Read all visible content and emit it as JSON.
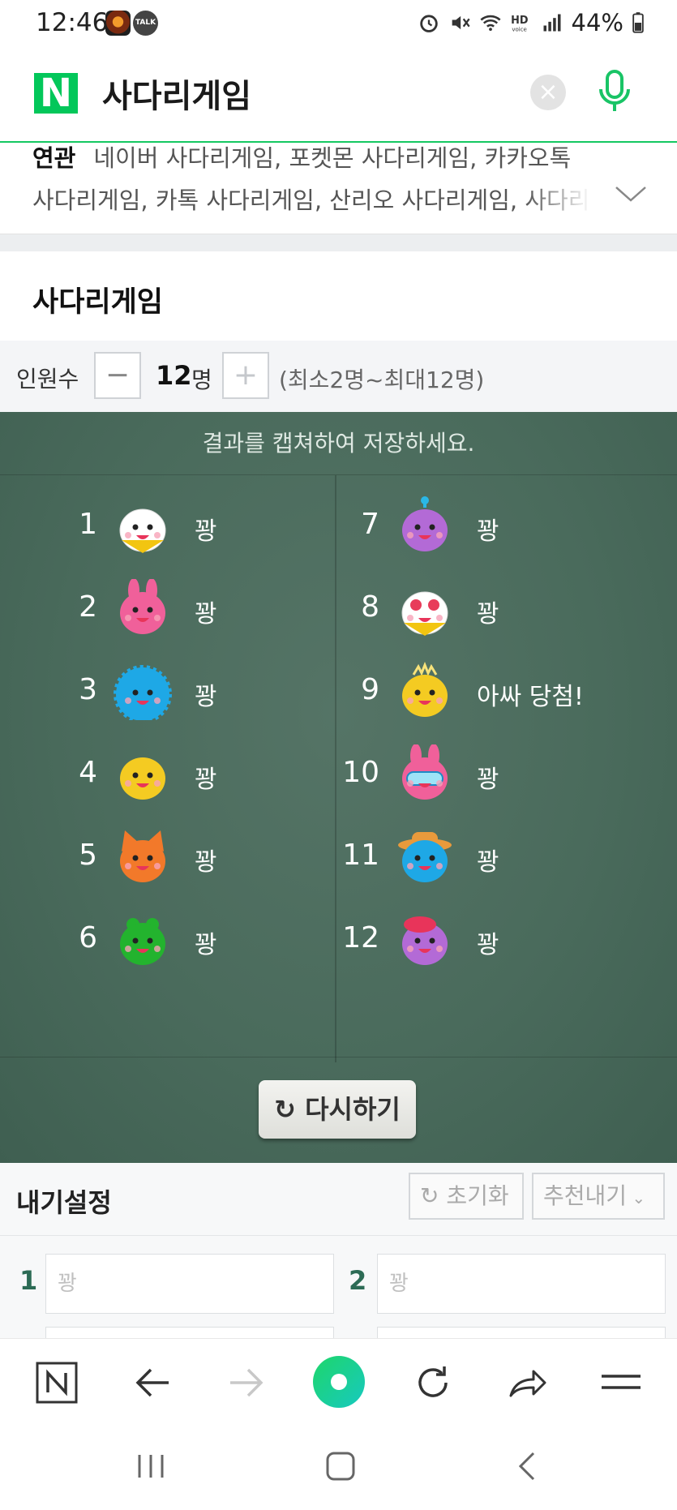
{
  "status_bar": {
    "time": "12:46",
    "battery": "44%"
  },
  "search": {
    "query": "사다리게임",
    "logo": "N",
    "clear_label": "×"
  },
  "related": {
    "label": "연관",
    "line1": "네이버 사다리게임, 포켓몬 사다리게임, 카카오톡",
    "line2": "사다리게임, 카톡 사다리게임, 산리오 사다리게임, 사다리"
  },
  "section_title": "사다리게임",
  "count": {
    "label": "인원수",
    "minus": "−",
    "value": "12",
    "unit": "명",
    "plus": "+",
    "range": "(최소2명~최대12명)"
  },
  "board": {
    "message": "결과를 캡쳐하여 저장하세요.",
    "retry_label": "다시하기",
    "players": [
      {
        "num": "1",
        "result": "꽝",
        "avatar": "white-bear"
      },
      {
        "num": "2",
        "result": "꽝",
        "avatar": "pink-rabbit"
      },
      {
        "num": "3",
        "result": "꽝",
        "avatar": "blue-hedgehog"
      },
      {
        "num": "4",
        "result": "꽝",
        "avatar": "yellow-blob"
      },
      {
        "num": "5",
        "result": "꽝",
        "avatar": "orange-fox"
      },
      {
        "num": "6",
        "result": "꽝",
        "avatar": "green-frog"
      },
      {
        "num": "7",
        "result": "꽝",
        "avatar": "purple-alien"
      },
      {
        "num": "8",
        "result": "꽝",
        "avatar": "bear-heart-glasses"
      },
      {
        "num": "9",
        "result": "아싸 당첨!",
        "avatar": "yellow-chick"
      },
      {
        "num": "10",
        "result": "꽝",
        "avatar": "rabbit-goggles"
      },
      {
        "num": "11",
        "result": "꽝",
        "avatar": "hedgehog-hat"
      },
      {
        "num": "12",
        "result": "꽝",
        "avatar": "purple-beret"
      }
    ]
  },
  "settings": {
    "title": "내기설정",
    "reset_label": "초기화",
    "recommend_label": "추천내기",
    "fields": [
      {
        "num": "1",
        "placeholder": "꽝"
      },
      {
        "num": "2",
        "placeholder": "꽝"
      }
    ]
  },
  "colors": {
    "naver_green": "#03c75a",
    "board": "#4a6b5c",
    "accent_num": "#2c6b55"
  }
}
